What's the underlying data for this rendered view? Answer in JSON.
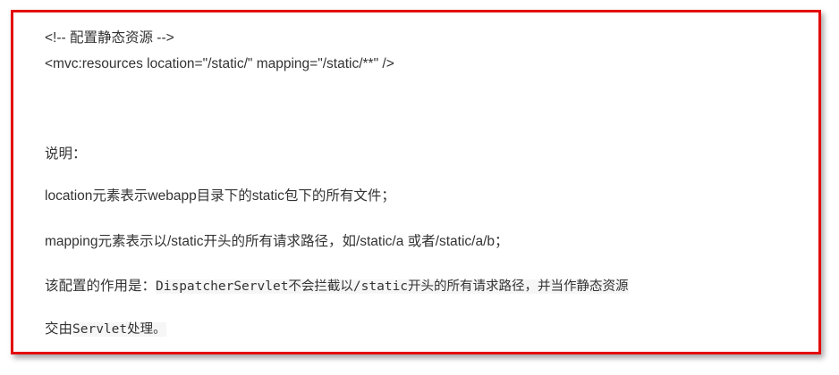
{
  "code": {
    "comment": "<!-- 配置静态资源 -->",
    "resources": "<mvc:resources location=\"/static/\" mapping=\"/static/**\" />"
  },
  "explanation": {
    "heading": "说明：",
    "location_desc": "location元素表示webapp目录下的static包下的所有文件；",
    "mapping_desc": "mapping元素表示以/static开头的所有请求路径，如/static/a 或者/static/a/b；",
    "effect_prefix": "该配置的作用是：",
    "effect_code": "DispatcherServlet不会拦截以/static开头的所有请求路径，并当作静态资源",
    "effect_line2_prefix": "交由",
    "effect_line2_code": "Servlet处理。"
  },
  "colors": {
    "border": "#e30d0d",
    "text": "#333333"
  }
}
